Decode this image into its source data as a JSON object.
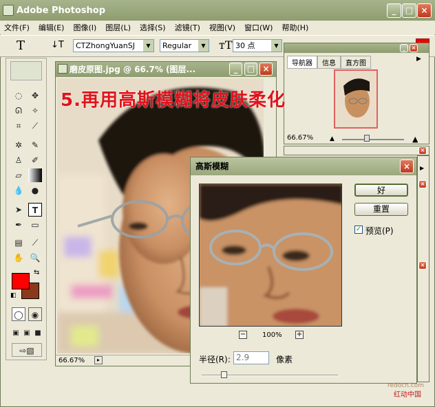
{
  "app": {
    "title": "Adobe Photoshop"
  },
  "menu": [
    "文件(F)",
    "编辑(E)",
    "图像(I)",
    "图层(L)",
    "选择(S)",
    "滤镜(T)",
    "视图(V)",
    "窗口(W)",
    "帮助(H)"
  ],
  "options": {
    "tool_glyph": "T",
    "font_family": "CTZhongYuanSJ",
    "font_style": "Regular",
    "font_size": "30 点"
  },
  "document": {
    "title": "磨皮原图.jpg @ 66.7% (图层...",
    "zoom": "66.67%",
    "caption": "5.再用高斯模糊将皮肤柔化"
  },
  "navigator": {
    "tabs": [
      "导航器",
      "信息",
      "直方图"
    ],
    "zoom": "66.67%"
  },
  "dialog": {
    "title": "高斯模糊",
    "ok_label": "好",
    "reset_label": "重置",
    "preview_label": "预览(P)",
    "preview_checked": true,
    "zoom": "100%",
    "zoom_out": "−",
    "zoom_in": "+",
    "radius_label": "半径(R):",
    "radius_value": "2.9",
    "radius_unit": "像素",
    "radius_fraction": 0.14
  },
  "colors": {
    "foreground": "#ff0000",
    "background": "#8a3a1c"
  },
  "watermark": {
    "site": "redocn.com",
    "cn": "红动中国"
  }
}
